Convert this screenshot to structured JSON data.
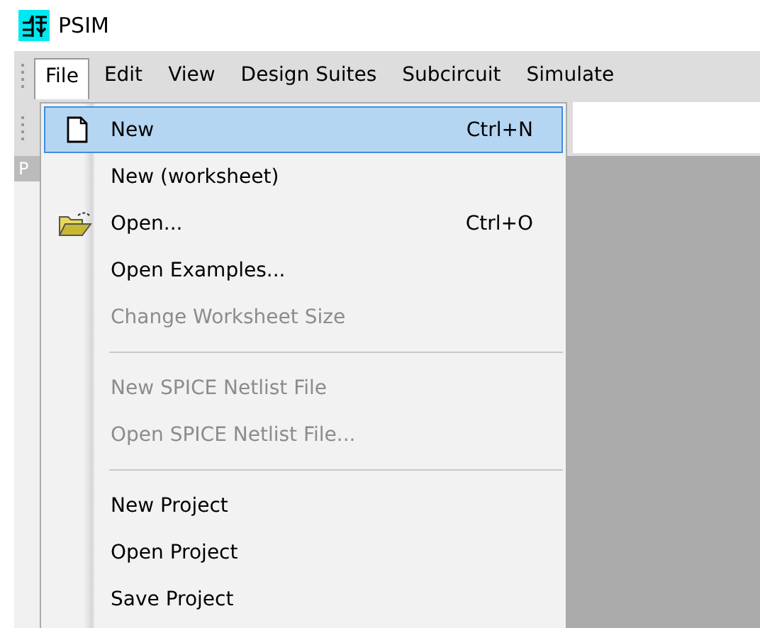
{
  "window": {
    "title": "PSIM"
  },
  "menubar": [
    {
      "label": "File",
      "selected": true
    },
    {
      "label": "Edit",
      "selected": false
    },
    {
      "label": "View",
      "selected": false
    },
    {
      "label": "Design Suites",
      "selected": false
    },
    {
      "label": "Subcircuit",
      "selected": false
    },
    {
      "label": "Simulate",
      "selected": false
    }
  ],
  "side_panel": {
    "tab": "P"
  },
  "file_menu": [
    {
      "kind": "page_item",
      "label": "New",
      "shortcut": "Ctrl+N",
      "selected": true,
      "disabled": false
    },
    {
      "kind": "item",
      "label": "New (worksheet)",
      "selected": false,
      "disabled": false
    },
    {
      "kind": "folder_item",
      "label": "Open...",
      "shortcut": "Ctrl+O",
      "selected": false,
      "disabled": false
    },
    {
      "kind": "item",
      "label": "Open Examples...",
      "selected": false,
      "disabled": false
    },
    {
      "kind": "item",
      "label": "Change Worksheet Size",
      "selected": false,
      "disabled": true
    },
    {
      "kind": "separator"
    },
    {
      "kind": "item",
      "label": "New SPICE Netlist File",
      "selected": false,
      "disabled": true
    },
    {
      "kind": "item",
      "label": "Open SPICE Netlist File...",
      "selected": false,
      "disabled": true
    },
    {
      "kind": "separator"
    },
    {
      "kind": "item",
      "label": "New Project",
      "selected": false,
      "disabled": false
    },
    {
      "kind": "item",
      "label": "Open Project",
      "selected": false,
      "disabled": false
    },
    {
      "kind": "item",
      "label": "Save Project",
      "selected": false,
      "disabled": false
    }
  ]
}
